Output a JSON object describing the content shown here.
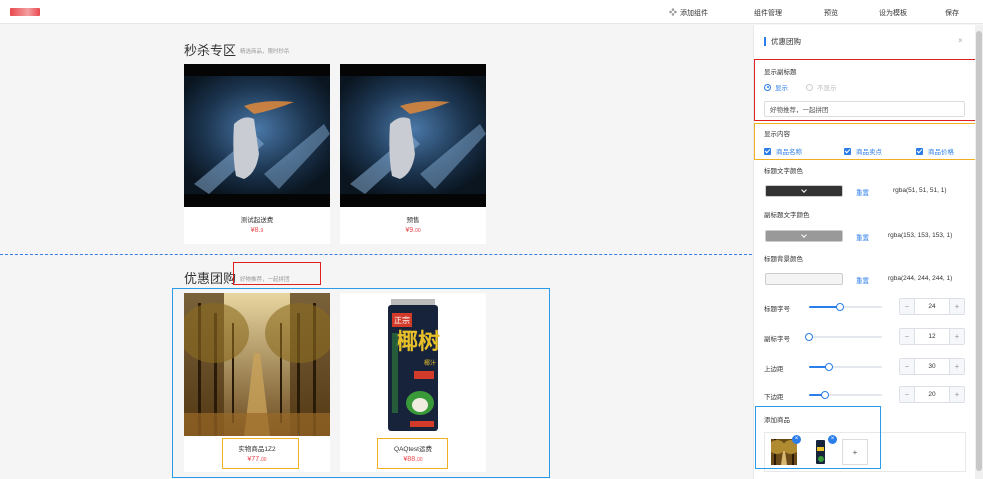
{
  "topbar": {
    "add_component": "添加组件",
    "component_manage": "组件管理",
    "preview": "预览",
    "set_template": "设为模板",
    "save": "保存"
  },
  "flash_sale": {
    "title": "秒杀专区",
    "subtitle": "精选商品，限时秒杀",
    "items": [
      {
        "name": "测试起送费",
        "currency": "¥",
        "int": "8.",
        "dec": "9"
      },
      {
        "name": "预售",
        "currency": "¥",
        "int": "9.",
        "dec": "00"
      }
    ]
  },
  "group_buy": {
    "title": "优惠团购",
    "subtitle": "好物推荐，一起拼团",
    "items": [
      {
        "name": "实物商品1Z2",
        "currency": "¥",
        "int": "77.",
        "dec": "00"
      },
      {
        "name": "QAQtest运费",
        "currency": "¥",
        "int": "88.",
        "dec": "00"
      }
    ],
    "can_label_1": "正宗",
    "can_label_2": "椰树",
    "can_label_3": "椰汁"
  },
  "panel": {
    "title": "优惠团购",
    "close": "×",
    "show_subtitle_label": "显示副标题",
    "show": "显示",
    "hide": "不显示",
    "subtitle_value": "好物推荐，一起拼团",
    "show_content_label": "显示内容",
    "chk_name": "商品名称",
    "chk_sold": "商品卖点",
    "chk_price": "商品价格",
    "title_color_label": "标题文字颜色",
    "title_color_value": "rgba(51, 51, 51, 1)",
    "subtitle_color_label": "副标题文字颜色",
    "subtitle_color_value": "rgba(153, 153, 153, 1)",
    "bg_color_label": "标题背景颜色",
    "bg_color_value": "rgba(244, 244, 244, 1)",
    "reset": "重置",
    "title_size_label": "标题字号",
    "title_size": "24",
    "subtitle_size_label": "副标字号",
    "subtitle_size": "12",
    "margin_top_label": "上边距",
    "margin_top": "30",
    "margin_bottom_label": "下边距",
    "margin_bottom": "20",
    "add_goods_label": "添加商品",
    "badge": "×",
    "plus": "+",
    "minus": "−"
  },
  "colors": {
    "accent": "#2b7de9",
    "price": "#e8484d",
    "swatch_title": "#333333",
    "swatch_subtitle": "#999999",
    "swatch_bg": "#f4f4f4"
  },
  "sliders": {
    "title_size": 0.42,
    "subtitle_size": 0.0,
    "margin_top": 0.28,
    "margin_bottom": 0.22
  }
}
